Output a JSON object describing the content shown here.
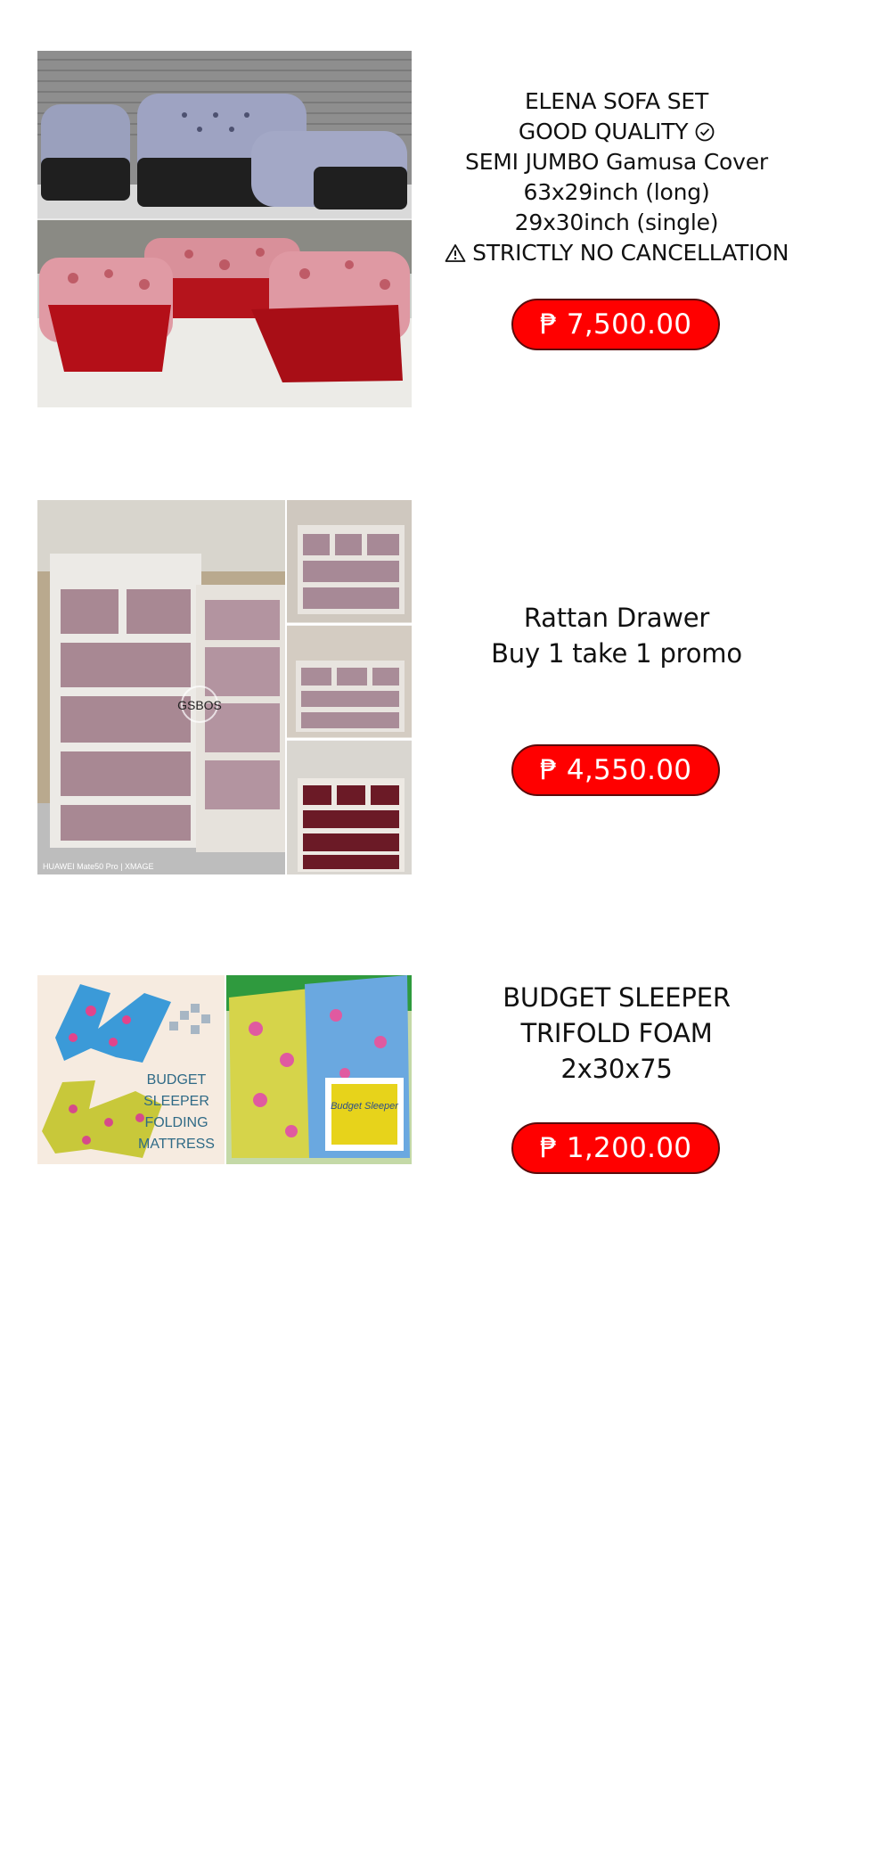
{
  "products": [
    {
      "lines": [
        "ELENA SOFA SET",
        "GOOD QUALITY",
        "SEMI JUMBO Gamusa Cover",
        "63x29inch (long)",
        "29x30inch (single)",
        "STRICTLY NO CANCELLATION"
      ],
      "check_glyph": "✓",
      "warning_glyph": "⚠",
      "price": "₱ 7,500.00",
      "image_icon": "sofa-set-photo"
    },
    {
      "lines": [
        "Rattan Drawer",
        "Buy 1 take 1 promo"
      ],
      "price": "₱ 4,550.00",
      "image_icon": "rattan-drawer-photo",
      "image_watermark": "GSBOS",
      "image_camera_mark": "HUAWEI Mate50 Pro | XMAGE"
    },
    {
      "lines": [
        "BUDGET SLEEPER",
        "TRIFOLD FOAM",
        "2x30x75"
      ],
      "price": "₱ 1,200.00",
      "image_icon": "trifold-foam-photo",
      "image_text": [
        "BUDGET",
        "SLEEPER",
        "FOLDING",
        "MATTRESS"
      ],
      "image_brand": "Budget Sleeper"
    }
  ],
  "colors": {
    "price_button_bg": "#ff0000",
    "price_button_text": "#ffffff",
    "page_bg": "#ffffff"
  }
}
